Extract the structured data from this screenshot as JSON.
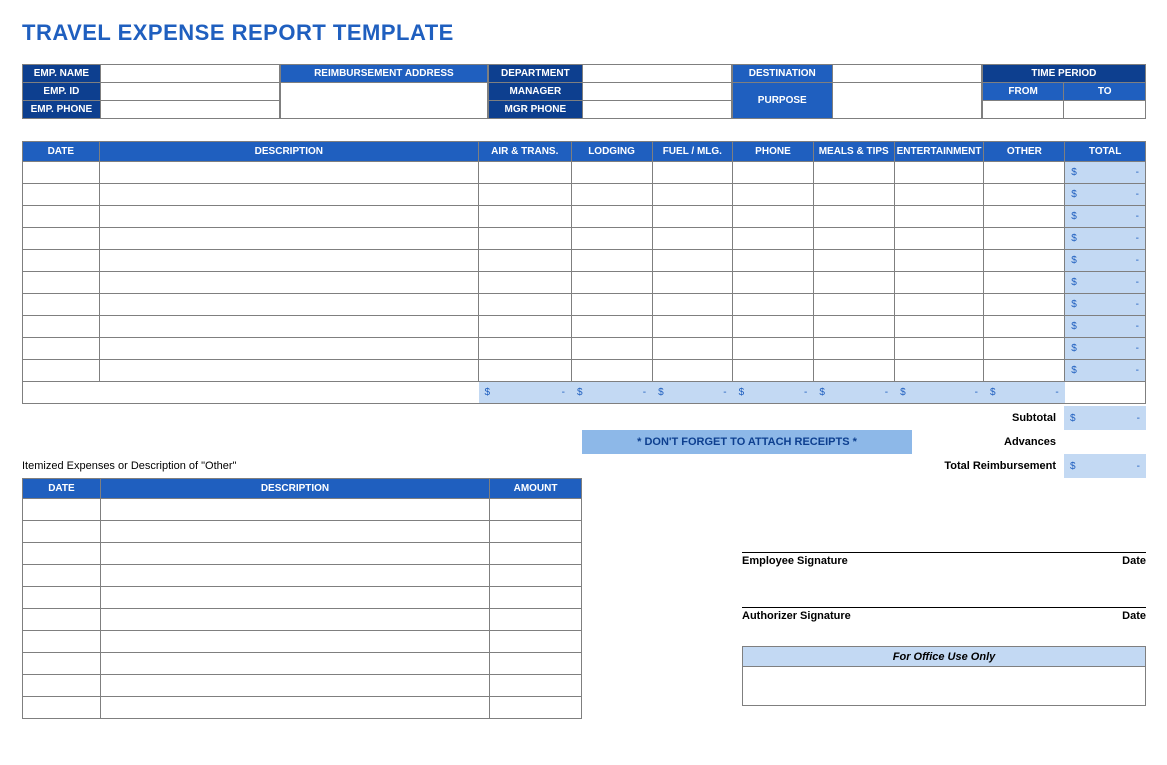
{
  "title": "TRAVEL EXPENSE REPORT TEMPLATE",
  "info": {
    "emp_name": "EMP. NAME",
    "emp_id": "EMP. ID",
    "emp_phone": "EMP. PHONE",
    "reimb_addr": "REIMBURSEMENT ADDRESS",
    "department": "DEPARTMENT",
    "manager": "MANAGER",
    "mgr_phone": "MGR PHONE",
    "destination": "DESTINATION",
    "purpose": "PURPOSE",
    "time_period": "TIME PERIOD",
    "from": "FROM",
    "to": "TO"
  },
  "main_headers": {
    "date": "DATE",
    "description": "DESCRIPTION",
    "air": "AIR & TRANS.",
    "lodging": "LODGING",
    "fuel": "FUEL / MLG.",
    "phone": "PHONE",
    "meals": "MEALS & TIPS",
    "ent": "ENTERTAINMENT",
    "other": "OTHER",
    "total": "TOTAL"
  },
  "main_rows": 10,
  "currency": "$",
  "dash": "-",
  "summary": {
    "subtotal": "Subtotal",
    "advances": "Advances",
    "total_reimb": "Total Reimbursement",
    "receipts": "*  DON'T FORGET TO ATTACH RECEIPTS  *"
  },
  "itemized": {
    "title": "Itemized Expenses or Description of \"Other\"",
    "date": "DATE",
    "description": "DESCRIPTION",
    "amount": "AMOUNT",
    "rows": 10
  },
  "sig": {
    "emp": "Employee Signature",
    "auth": "Authorizer Signature",
    "date": "Date",
    "office": "For Office Use Only"
  }
}
